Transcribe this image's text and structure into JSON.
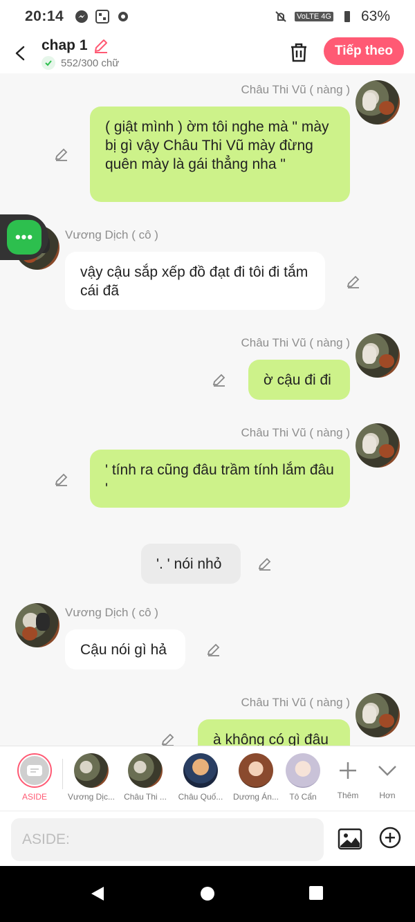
{
  "status_bar": {
    "time": "20:14",
    "battery": "63%",
    "network": "VoLTE 4G"
  },
  "header": {
    "back_icon": "chevron-left-icon",
    "title": "chap 1",
    "word_count": "552/300 chữ",
    "next_label": "Tiếp theo",
    "accent_color": "#ff5a74"
  },
  "messages": [
    {
      "speaker": "Châu Thi Vũ ( nàng )",
      "side": "right",
      "text": "( giật mình ) ờm tôi nghe mà \" mày bị gì vậy Châu Thi Vũ mày đừng quên mày là gái thẳng nha \""
    },
    {
      "speaker": "Vương Dịch ( cô )",
      "side": "left",
      "text": "vậy cậu sắp xếp đồ đạt đi tôi đi tắm cái đã"
    },
    {
      "speaker": "Châu Thi Vũ ( nàng )",
      "side": "right",
      "text": "ờ cậu đi đi"
    },
    {
      "speaker": "Châu Thi Vũ ( nàng )",
      "side": "right",
      "text": "' tính ra cũng đâu trầm tính lắm đâu '"
    },
    {
      "speaker": "",
      "side": "center",
      "text": "'. ' nói nhỏ"
    },
    {
      "speaker": "Vương Dịch ( cô )",
      "side": "left",
      "text": "Cậu nói gì hả"
    },
    {
      "speaker": "Châu Thi Vũ ( nàng )",
      "side": "right",
      "text": "à không có gì đâu"
    }
  ],
  "characters": [
    {
      "label": "ASIDE"
    },
    {
      "label": "Vương Dịc..."
    },
    {
      "label": "Châu Thi ..."
    },
    {
      "label": "Châu Quố..."
    },
    {
      "label": "Dương Án..."
    },
    {
      "label": "Tô Cẩn"
    },
    {
      "label": "Thêm"
    },
    {
      "label": "Hơn"
    }
  ],
  "composer": {
    "placeholder": "ASIDE:"
  },
  "colors": {
    "green_bubble": "#cdf28a",
    "white_bubble": "#ffffff",
    "float_button": "#2dbf4e"
  }
}
